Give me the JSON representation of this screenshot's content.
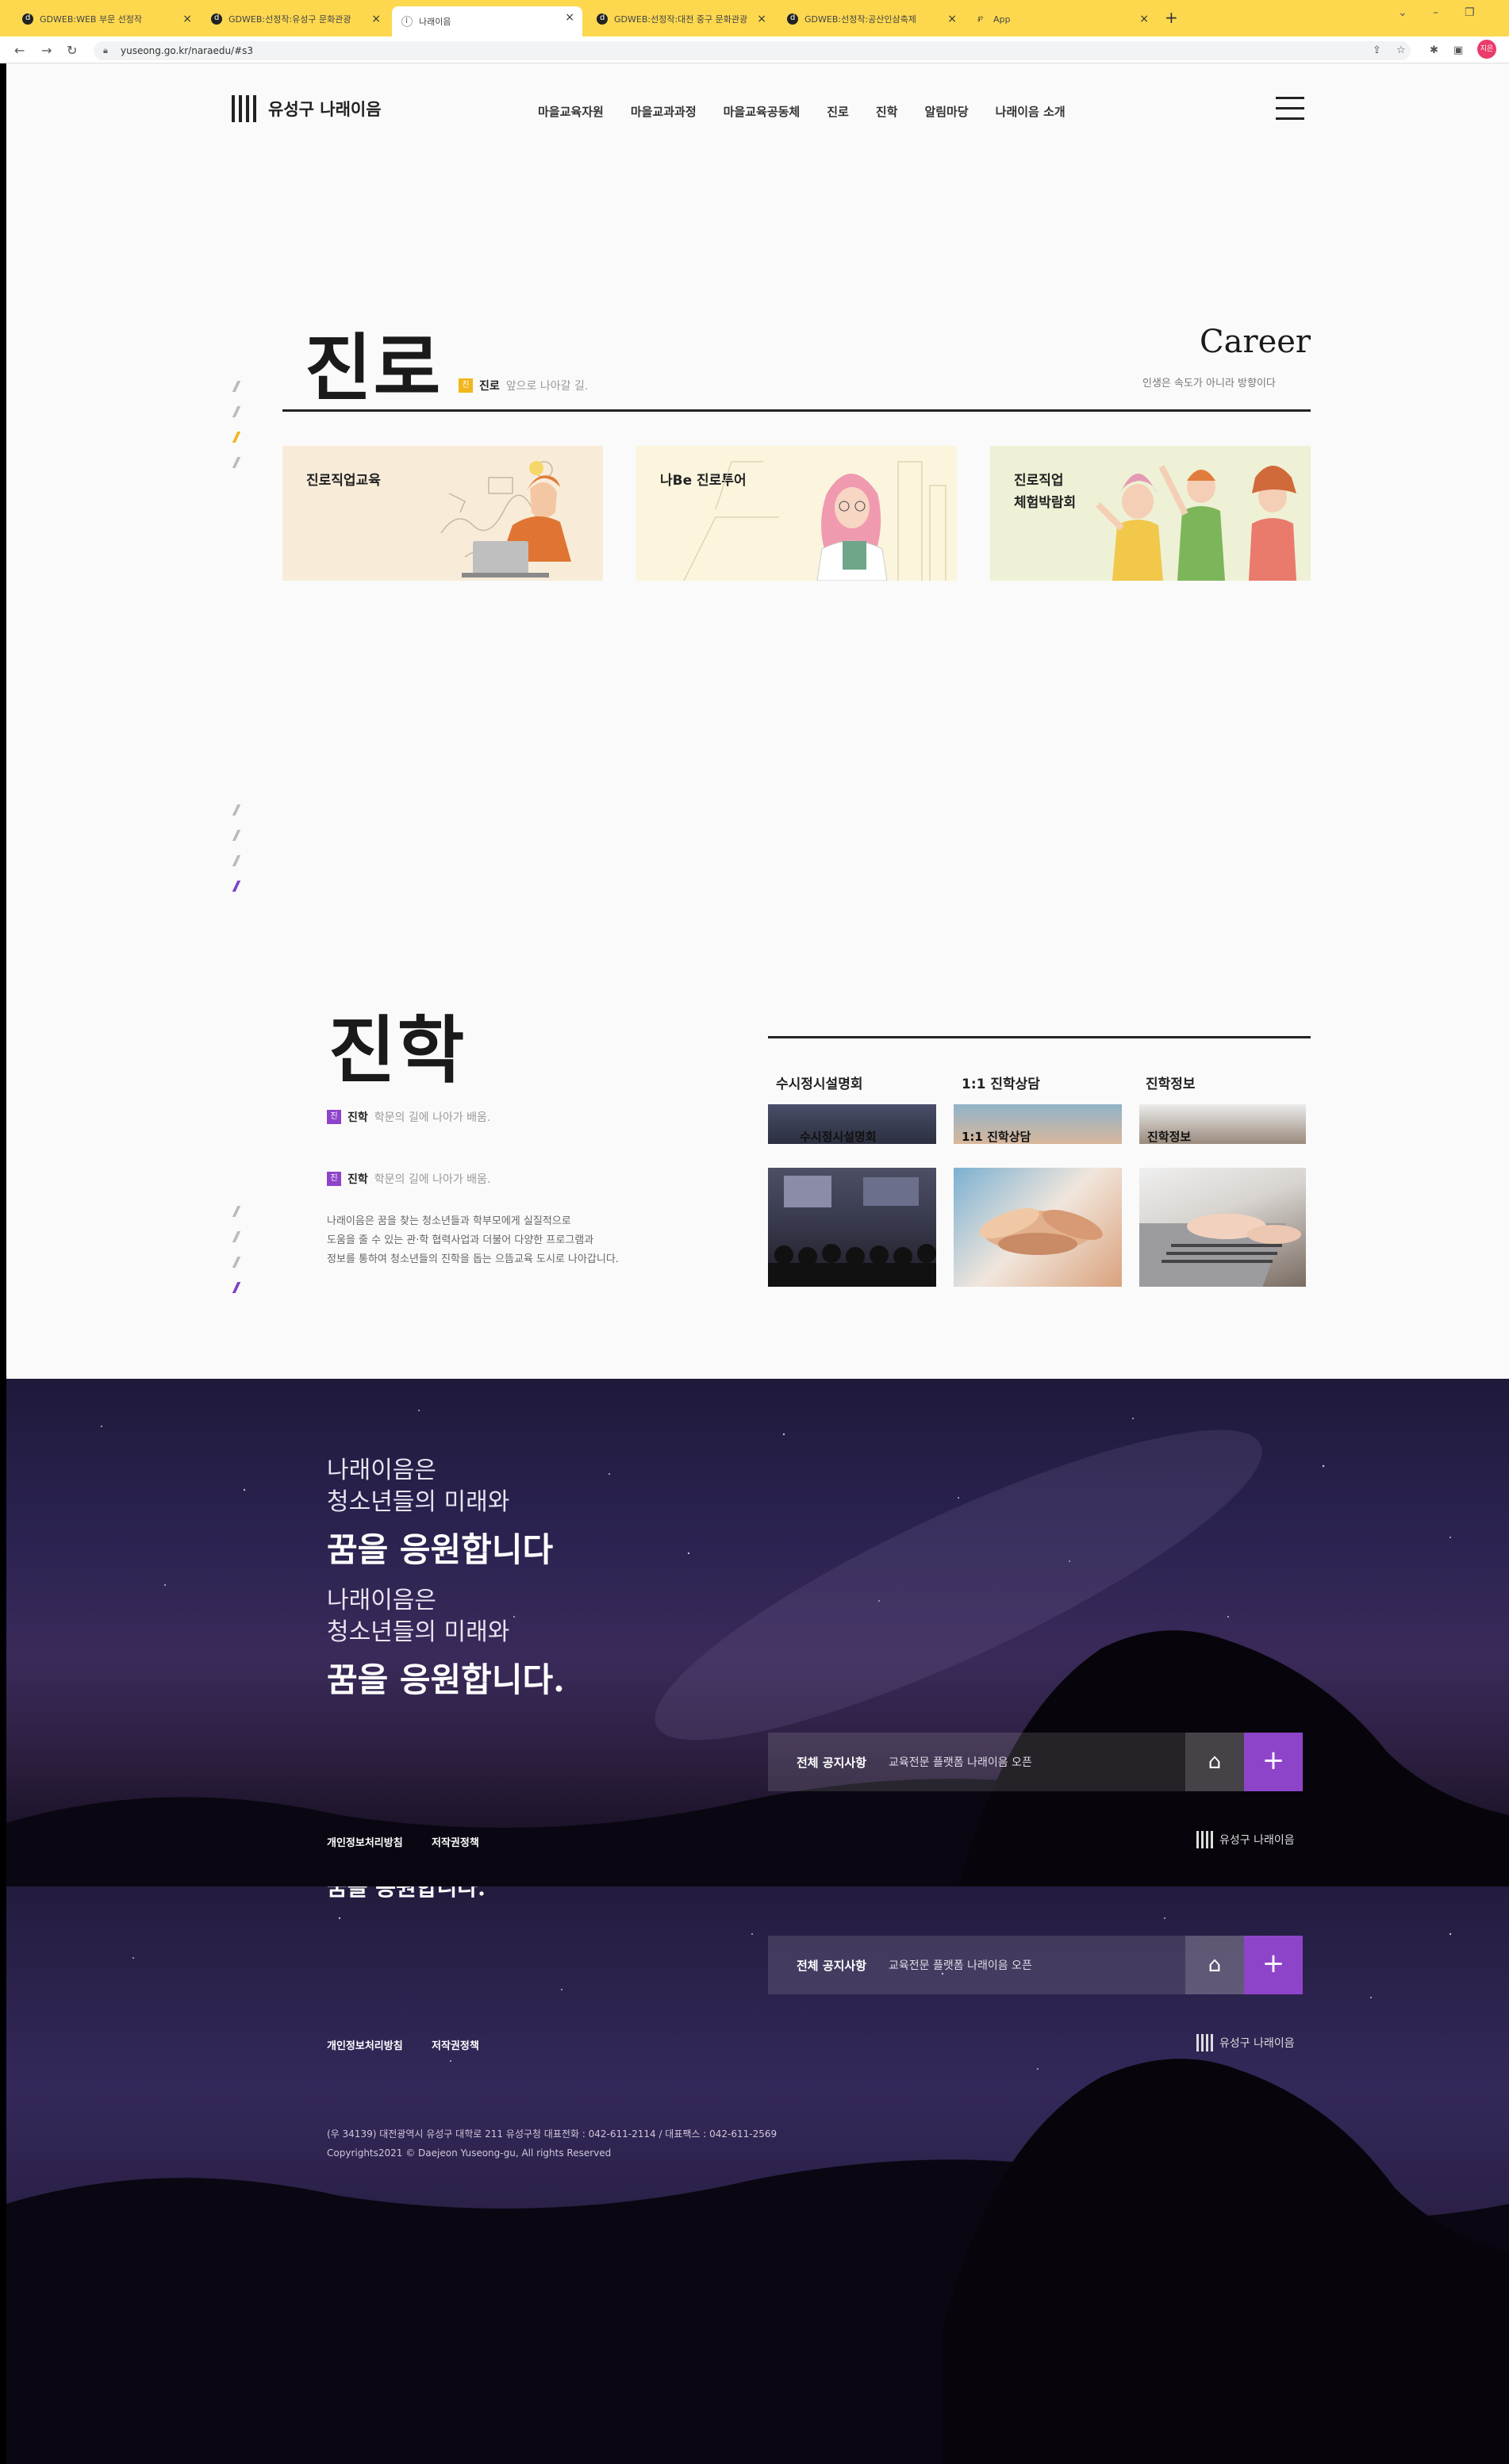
{
  "browser": {
    "tabs": [
      {
        "label": "GDWEB:WEB 부문 선정작"
      },
      {
        "label": "GDWEB:선정작:유성구 문화관광"
      },
      {
        "label": "나래이음"
      },
      {
        "label": "GDWEB:선정작:대전 중구 문화관광"
      },
      {
        "label": "GDWEB:선정작:공산인삼축제"
      },
      {
        "label": "App"
      }
    ],
    "url": "yuseong.go.kr/naraedu/#s3",
    "profile": "지은"
  },
  "header": {
    "logo": "유성구 나래이음",
    "nav": [
      "마을교육자원",
      "마을교과과정",
      "마을교육공동체",
      "진로",
      "진학",
      "알림마당",
      "나래이음 소개"
    ]
  },
  "career": {
    "title": "진로",
    "tag_icon": "진",
    "tag_label": "진로",
    "tag_desc": "앞으로 나아갈 길.",
    "title_en": "Career",
    "subtitle": "인생은 속도가 아니라 방향이다",
    "cards": [
      {
        "label": "진로직업교육"
      },
      {
        "label": "나Be 진로투어"
      },
      {
        "label": "진로직업\n체험박람회"
      }
    ]
  },
  "advance": {
    "title": "진학",
    "tag_icon": "진",
    "tag_label": "진학",
    "tag_desc": "학문의 길에 나아가 배움.",
    "tag2_label": "진학",
    "tag2_desc": "학문의 길에 나아가 배움.",
    "description": [
      "나래이음은 꿈을 찾는 청소년들과 학부모에게 실질적으로",
      "도움을 줄 수 있는 관·학 협력사업과 더불어 다양한 프로그램과",
      "정보를 통하여 청소년들의 진학을 돕는 으뜸교육 도시로 나아갑니다."
    ],
    "tabs": [
      "수시정시설명회",
      "1:1 진학상담",
      "진학정보"
    ],
    "overlap_labels": [
      "수시정시설명회",
      "1:1 진학상담",
      "진학정보"
    ]
  },
  "footer": {
    "slogan_1": "나래이음은",
    "slogan_2": "청소년들의 미래와",
    "slogan_3": "꿈을 응원합니다",
    "slogan_3b": "꿈을 응원합니다.",
    "notice_label": "전체 공지사항",
    "notice_text": "교육전문 플랫폼 나래이음 오픈",
    "links": [
      "개인정보처리방침",
      "저작권정책"
    ],
    "logo": "유성구 나래이음",
    "address": "(우 34139) 대전광역시 유성구 대학로 211 유성구청 대표전화 : 042-611-2114 / 대표팩스 : 042-611-2569",
    "copyright": "Copyrights2021 © Daejeon Yuseong-gu, All rights Reserved"
  },
  "colors": {
    "accent_yellow": "#f2b51c",
    "accent_purple": "#8e44c9",
    "chrome_yellow": "#fdd84f"
  }
}
